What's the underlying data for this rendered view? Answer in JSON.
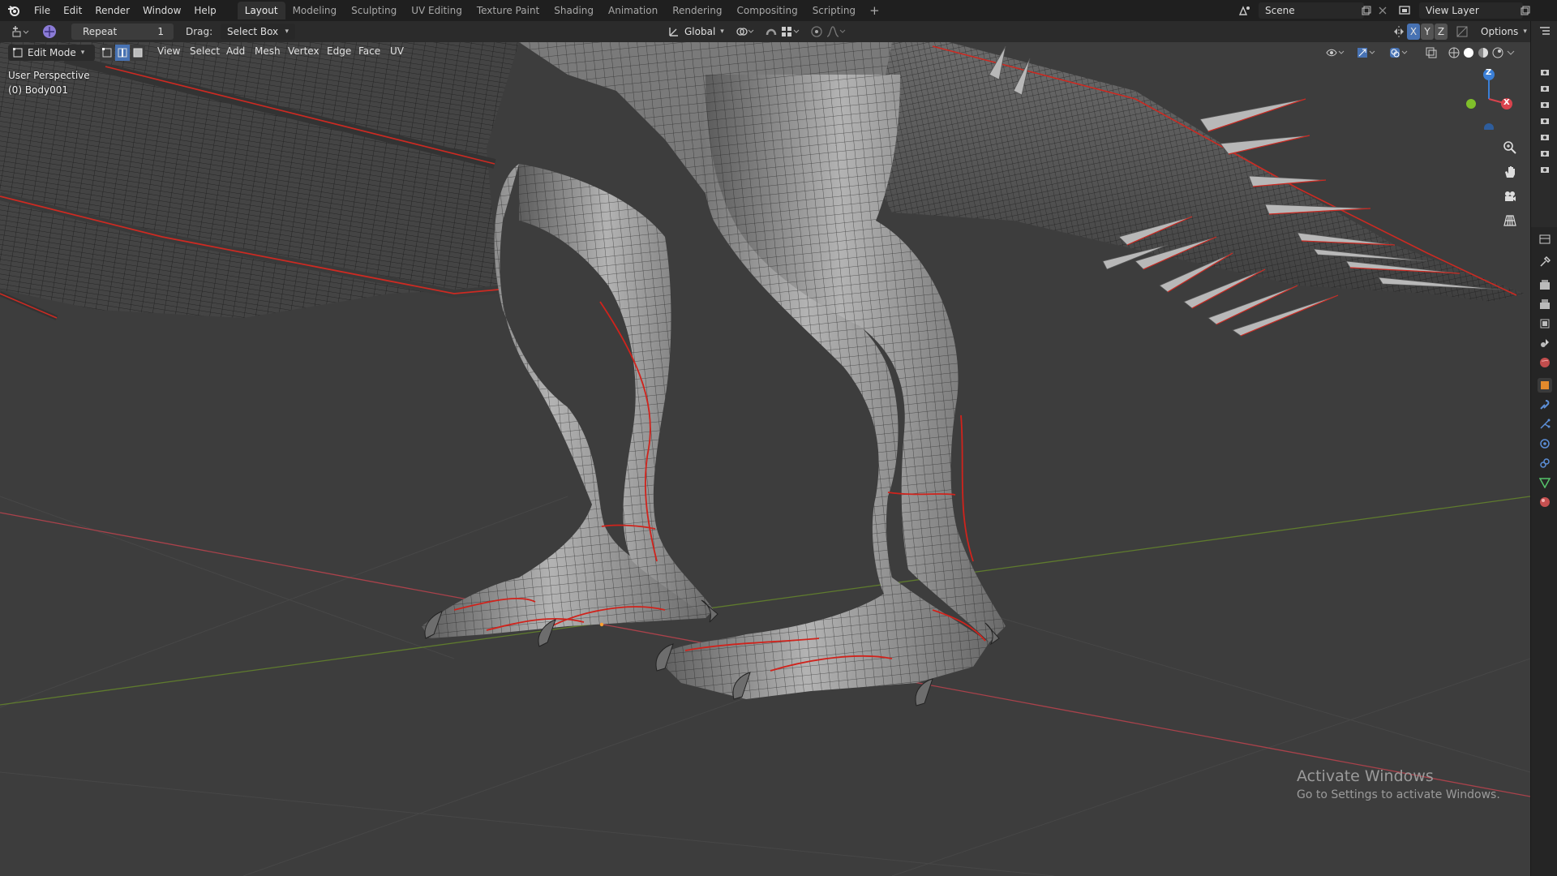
{
  "menu": {
    "items": [
      "File",
      "Edit",
      "Render",
      "Window",
      "Help"
    ]
  },
  "workspaces": {
    "tabs": [
      "Layout",
      "Modeling",
      "Sculpting",
      "UV Editing",
      "Texture Paint",
      "Shading",
      "Animation",
      "Rendering",
      "Compositing",
      "Scripting"
    ],
    "active": "Layout",
    "add": "+"
  },
  "scene": {
    "name": "Scene"
  },
  "view_layer": {
    "name": "View Layer"
  },
  "tool_header": {
    "repeat_label": "Repeat",
    "repeat_count": "1",
    "drag_label": "Drag:",
    "drag_value": "Select Box",
    "orientation": "Global",
    "options": "Options",
    "axis_x": "X",
    "axis_y": "Y",
    "axis_z": "Z"
  },
  "edit_header": {
    "mode": "Edit Mode",
    "menus": [
      "View",
      "Select",
      "Add",
      "Mesh",
      "Vertex",
      "Edge",
      "Face",
      "UV"
    ]
  },
  "viewport": {
    "perspective": "User Perspective",
    "object": "(0) Body001",
    "bg_color": "#3d3d3d",
    "mesh_color": "#8a8a8a",
    "seam_color": "#e0201a",
    "x_axis_color": "#b0404a",
    "y_axis_color": "#6b8a30"
  },
  "gizmo": {
    "z": "Z",
    "x": "X"
  },
  "watermark": {
    "line1": "Activate Windows",
    "line2": "Go to Settings to activate Windows."
  }
}
